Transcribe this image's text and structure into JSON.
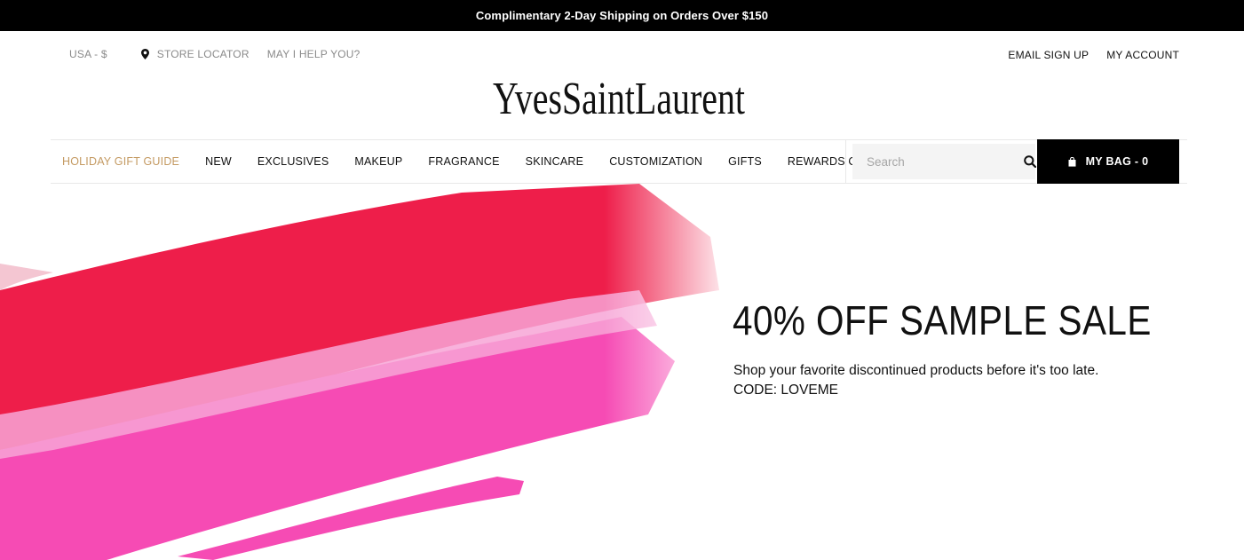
{
  "promo": {
    "text": "Complimentary 2-Day Shipping on Orders Over $150"
  },
  "utility": {
    "currency": "USA - $",
    "store_locator": "STORE LOCATOR",
    "help": "MAY I HELP YOU?",
    "email_signup": "EMAIL SIGN UP",
    "account": "MY ACCOUNT"
  },
  "brand": {
    "logo_text": "YvesSaintLaurent"
  },
  "nav": {
    "items": [
      {
        "label": "HOLIDAY GIFT GUIDE",
        "highlight": true
      },
      {
        "label": "NEW"
      },
      {
        "label": "EXCLUSIVES"
      },
      {
        "label": "MAKEUP"
      },
      {
        "label": "FRAGRANCE"
      },
      {
        "label": "SKINCARE"
      },
      {
        "label": "CUSTOMIZATION"
      },
      {
        "label": "GIFTS"
      },
      {
        "label": "REWARDS CLUB"
      }
    ],
    "highlight_color": "#c49a62"
  },
  "search": {
    "placeholder": "Search",
    "icon": "search-icon"
  },
  "bag": {
    "label": "MY BAG - 0",
    "icon": "shopping-bag-icon"
  },
  "hero": {
    "title": "40% OFF SAMPLE SALE",
    "body": "Shop your favorite discontinued products before it's too late.",
    "code": "CODE: LOVEME",
    "colors": {
      "red": "#ee1e4a",
      "pink": "#f64bb4"
    }
  }
}
